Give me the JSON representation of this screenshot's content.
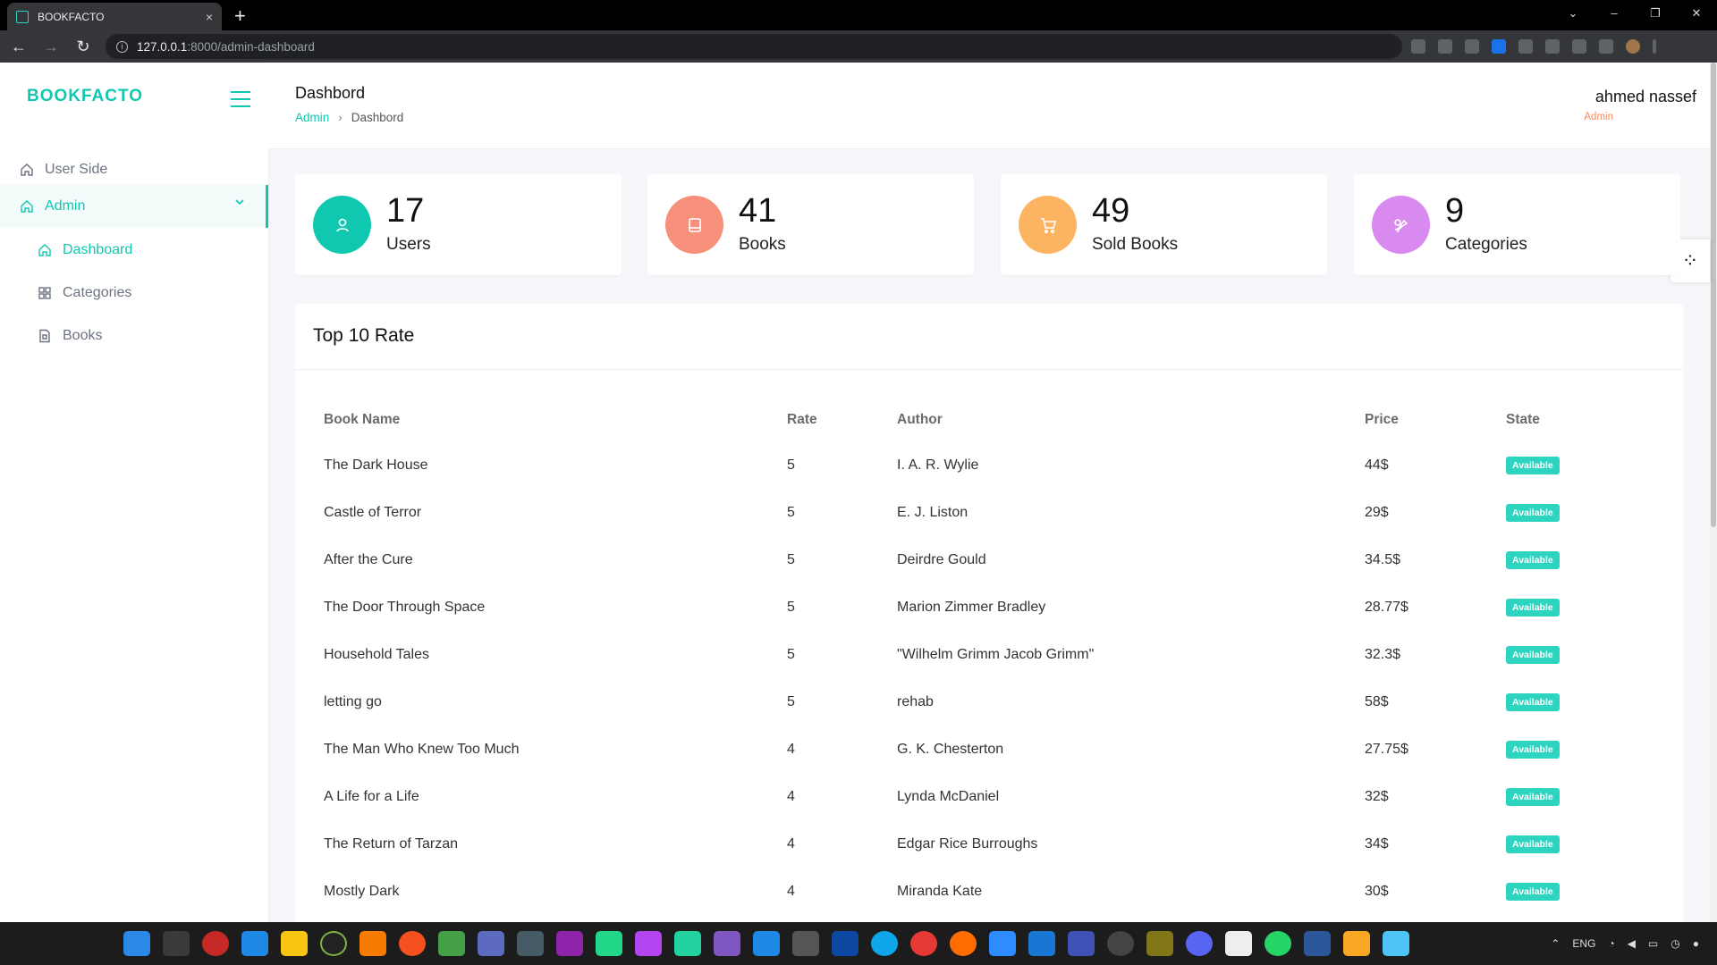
{
  "browser": {
    "tab_title": "BOOKFACTO",
    "tab_close": "×",
    "new_tab": "+",
    "url_host": "127.0.0.1",
    "url_path": ":8000/admin-dashboard"
  },
  "sidebar": {
    "brand": "BOOKFACTO",
    "items": [
      {
        "label": "User Side"
      },
      {
        "label": "Admin"
      },
      {
        "label": "Dashboard"
      },
      {
        "label": "Categories"
      },
      {
        "label": "Books"
      }
    ]
  },
  "header": {
    "title": "Dashbord",
    "breadcrumb": [
      "Admin",
      "Dashbord"
    ],
    "user_name": "ahmed nassef",
    "user_role": "Admin"
  },
  "stats": [
    {
      "value": "17",
      "label": "Users",
      "color": "#10c8b0",
      "icon": "user-icon"
    },
    {
      "value": "41",
      "label": "Books",
      "color": "#f7907a",
      "icon": "book-icon"
    },
    {
      "value": "49",
      "label": "Sold Books",
      "color": "#fdb462",
      "icon": "cart-icon"
    },
    {
      "value": "9",
      "label": "Categories",
      "color": "#d98af0",
      "icon": "category-icon"
    }
  ],
  "table": {
    "title": "Top 10 Rate",
    "columns": [
      "Book Name",
      "Rate",
      "Author",
      "Price",
      "State"
    ],
    "rows": [
      [
        "The Dark House",
        "5",
        "I. A. R. Wylie",
        "44$",
        "Available"
      ],
      [
        "Castle of Terror",
        "5",
        "E. J. Liston",
        "29$",
        "Available"
      ],
      [
        "After the Cure",
        "5",
        "Deirdre Gould",
        "34.5$",
        "Available"
      ],
      [
        "The Door Through Space",
        "5",
        "Marion Zimmer Bradley",
        "28.77$",
        "Available"
      ],
      [
        "Household Tales",
        "5",
        "\"Wilhelm Grimm Jacob Grimm\"",
        "32.3$",
        "Available"
      ],
      [
        "letting go",
        "5",
        "rehab",
        "58$",
        "Available"
      ],
      [
        "The Man Who Knew Too Much",
        "4",
        "G. K. Chesterton",
        "27.75$",
        "Available"
      ],
      [
        "A Life for a Life",
        "4",
        "Lynda McDaniel",
        "32$",
        "Available"
      ],
      [
        "The Return of Tarzan",
        "4",
        "Edgar Rice Burroughs",
        "34$",
        "Available"
      ],
      [
        "Mostly Dark",
        "4",
        "Miranda Kate",
        "30$",
        "Available"
      ]
    ]
  },
  "taskbar": {
    "language": "ENG"
  }
}
